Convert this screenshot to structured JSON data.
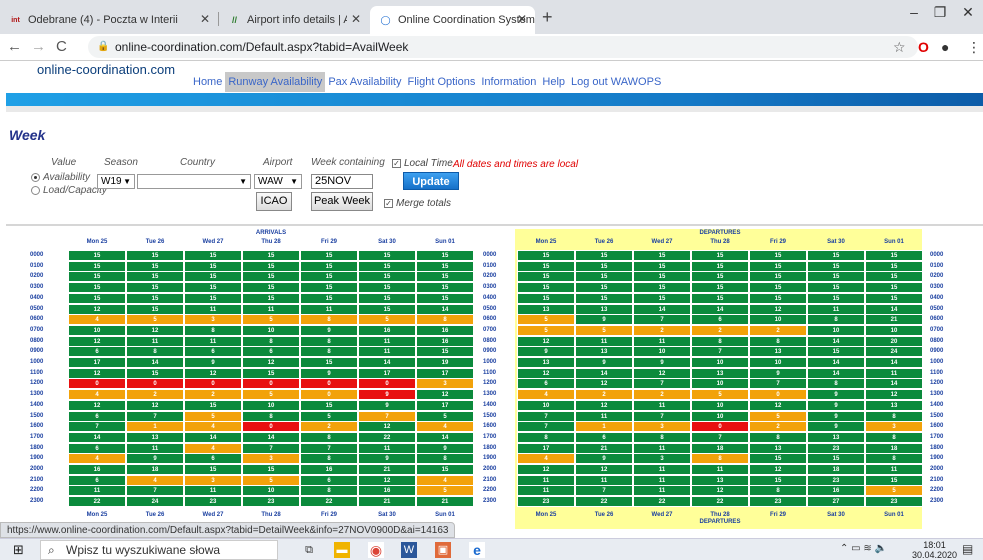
{
  "browser": {
    "tabs": [
      {
        "label": "Odebrane (4) - Poczta w Interii",
        "icon": "int"
      },
      {
        "label": "Airport info details | Airport Coor",
        "icon": "//"
      },
      {
        "label": "Online Coordination System",
        "icon": "◯"
      }
    ],
    "url": "online-coordination.com/Default.aspx?tabid=AvailWeek",
    "status_url": "https://www.online-coordination.com/Default.aspx?tabid=DetailWeek&info=27NOV0900D&ai=14163"
  },
  "site": {
    "logo": "online-coordination.com",
    "nav": [
      "Home",
      "Runway Availability",
      "Pax Availability",
      "Flight Options",
      "Information",
      "Help",
      "Log out WAWOPS"
    ],
    "active_nav": "Runway Availability"
  },
  "page": {
    "title": "Week"
  },
  "form": {
    "labels": {
      "value": "Value",
      "season": "Season",
      "country": "Country",
      "airport": "Airport",
      "week": "Week containing"
    },
    "value_options": [
      "Availability",
      "Load/Capacity"
    ],
    "season": "W19",
    "country": "",
    "airport": "WAW",
    "week": "25NOV",
    "local_time_label": "Local Time",
    "local_note": "All dates and times are local",
    "merge_label": "Merge totals",
    "buttons": {
      "update": "Update",
      "icao": "ICAO",
      "peak": "Peak Week"
    }
  },
  "days": [
    "Mon 25",
    "Tue 26",
    "Wed 27",
    "Thu 28",
    "Fri 29",
    "Sat 30",
    "Sun 01"
  ],
  "hours": [
    "0000",
    "0100",
    "0200",
    "0300",
    "0400",
    "0500",
    "0600",
    "0700",
    "0800",
    "0900",
    "1000",
    "1100",
    "1200",
    "1300",
    "1400",
    "1500",
    "1600",
    "1700",
    "1800",
    "1900",
    "2000",
    "2100",
    "2200",
    "2300"
  ],
  "colors": {
    "green": "#0b8a3c",
    "orange": "#f2a20a",
    "red": "#e81010",
    "departures_bg": "#ffff99"
  },
  "arrivals": {
    "title": "ARRIVALS",
    "rows": [
      [
        15,
        15,
        15,
        15,
        15,
        15,
        15
      ],
      [
        15,
        15,
        15,
        15,
        15,
        15,
        15
      ],
      [
        15,
        15,
        15,
        15,
        15,
        15,
        15
      ],
      [
        15,
        15,
        15,
        15,
        15,
        15,
        15
      ],
      [
        15,
        15,
        15,
        15,
        15,
        15,
        15
      ],
      [
        12,
        15,
        11,
        11,
        11,
        15,
        14
      ],
      [
        4,
        5,
        3,
        5,
        8,
        5,
        8
      ],
      [
        10,
        12,
        8,
        10,
        9,
        16,
        16
      ],
      [
        12,
        11,
        11,
        8,
        8,
        11,
        16
      ],
      [
        6,
        8,
        6,
        6,
        8,
        11,
        15
      ],
      [
        17,
        14,
        9,
        12,
        15,
        14,
        19
      ],
      [
        12,
        15,
        12,
        15,
        9,
        17,
        17
      ],
      [
        0,
        0,
        0,
        0,
        0,
        0,
        3
      ],
      [
        4,
        2,
        2,
        5,
        0,
        9,
        12
      ],
      [
        12,
        12,
        15,
        10,
        15,
        9,
        17
      ],
      [
        6,
        7,
        5,
        8,
        5,
        7,
        5
      ],
      [
        7,
        1,
        4,
        0,
        2,
        12,
        4
      ],
      [
        14,
        13,
        14,
        14,
        8,
        22,
        14
      ],
      [
        6,
        11,
        4,
        7,
        7,
        11,
        9
      ],
      [
        4,
        9,
        6,
        3,
        8,
        9,
        8
      ],
      [
        16,
        18,
        15,
        15,
        16,
        21,
        15
      ],
      [
        6,
        4,
        3,
        5,
        6,
        12,
        4
      ],
      [
        11,
        7,
        11,
        10,
        8,
        16,
        5
      ],
      [
        22,
        24,
        23,
        23,
        22,
        21,
        21
      ]
    ],
    "status": [
      "ggggggg",
      "ggggggg",
      "ggggggg",
      "ggggggg",
      "ggggggg",
      "ggggggg",
      "ooooooo",
      "ggggggg",
      "ggggggg",
      "ggggggg",
      "ggggggg",
      "ggggggg",
      "rrrrrro",
      "ooooorg",
      "ggggggg",
      "ggoggog",
      "goorogo",
      "ggggggg",
      "ggogggg",
      "oggoggg",
      "ggggggg",
      "goooggo",
      "ggggggo",
      "ggggggg"
    ]
  },
  "departures": {
    "title": "DEPARTURES",
    "rows": [
      [
        15,
        15,
        15,
        15,
        15,
        15,
        15
      ],
      [
        15,
        15,
        15,
        15,
        15,
        15,
        15
      ],
      [
        15,
        15,
        15,
        15,
        15,
        15,
        15
      ],
      [
        15,
        15,
        15,
        15,
        15,
        15,
        15
      ],
      [
        15,
        15,
        15,
        15,
        15,
        15,
        15
      ],
      [
        13,
        13,
        14,
        14,
        12,
        11,
        14
      ],
      [
        5,
        9,
        7,
        6,
        10,
        8,
        21
      ],
      [
        5,
        5,
        2,
        2,
        2,
        10,
        10
      ],
      [
        12,
        11,
        11,
        8,
        8,
        14,
        20
      ],
      [
        9,
        13,
        10,
        7,
        13,
        15,
        24
      ],
      [
        13,
        9,
        9,
        10,
        10,
        14,
        14
      ],
      [
        12,
        14,
        12,
        13,
        9,
        14,
        11
      ],
      [
        6,
        12,
        7,
        10,
        7,
        8,
        14
      ],
      [
        4,
        2,
        2,
        5,
        0,
        9,
        12
      ],
      [
        10,
        12,
        11,
        10,
        12,
        9,
        13
      ],
      [
        7,
        11,
        7,
        10,
        5,
        9,
        8
      ],
      [
        7,
        1,
        3,
        0,
        2,
        9,
        3
      ],
      [
        8,
        6,
        8,
        7,
        8,
        13,
        8
      ],
      [
        17,
        21,
        11,
        18,
        13,
        23,
        18
      ],
      [
        4,
        9,
        3,
        8,
        15,
        15,
        8
      ],
      [
        12,
        12,
        11,
        11,
        12,
        18,
        11
      ],
      [
        11,
        11,
        11,
        13,
        15,
        23,
        15
      ],
      [
        11,
        7,
        11,
        12,
        8,
        16,
        5
      ],
      [
        23,
        22,
        22,
        22,
        23,
        27,
        23
      ]
    ],
    "status": [
      "ggggggg",
      "ggggggg",
      "ggggggg",
      "ggggggg",
      "ggggggg",
      "ggggggg",
      "ogggggg",
      "ooooogg",
      "ggggggg",
      "ggggggg",
      "ggggggg",
      "ggggggg",
      "ggggggg",
      "ooooogg",
      "ggggggg",
      "ggggogg",
      "goorogo",
      "ggggggg",
      "ggggggg",
      "oggoggg",
      "ggggggg",
      "ggggggg",
      "ggggggo",
      "ggggggg"
    ]
  },
  "taskbar": {
    "search_placeholder": "Wpisz tu wyszukiwane słowa",
    "time": "18:01",
    "date": "30.04.2020"
  }
}
